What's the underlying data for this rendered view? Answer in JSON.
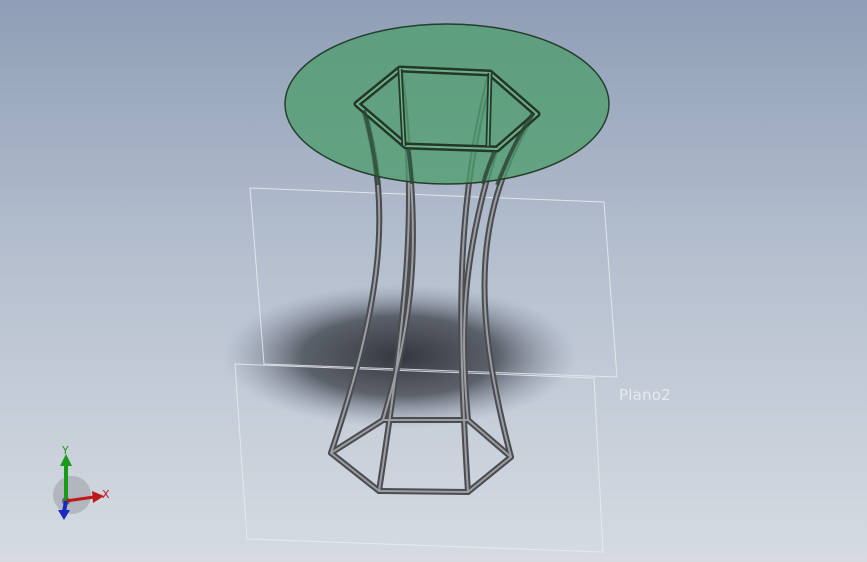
{
  "viewport": {
    "reference_plane_label": "Plano2",
    "colors": {
      "background_top": "#8f9eb6",
      "background_bottom": "#d6dbe2",
      "tabletop": "#4f9e6e",
      "frame": "#5b5d5f",
      "plane_outline": "#e8ecf1"
    }
  },
  "triad": {
    "x_label": "X",
    "y_label": "Y",
    "x_color": "#c01818",
    "y_color": "#1a9a1a",
    "z_color": "#1a2ac0"
  }
}
